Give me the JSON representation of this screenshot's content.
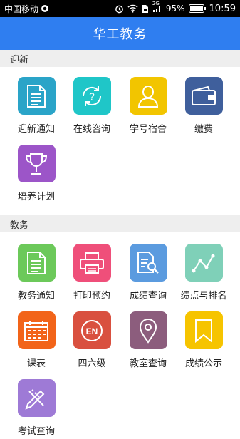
{
  "status_bar": {
    "carrier": "中国移动",
    "network": "2G",
    "battery": "95%",
    "time": "10:59"
  },
  "header": {
    "title": "华工教务"
  },
  "sections": [
    {
      "title": "迎新",
      "items": [
        {
          "label": "迎新通知",
          "icon": "document-icon",
          "color": "#2aa4c8"
        },
        {
          "label": "在线咨询",
          "icon": "help-refresh-icon",
          "color": "#1fc6c8"
        },
        {
          "label": "学号宿舍",
          "icon": "user-icon",
          "color": "#f2c500"
        },
        {
          "label": "缴费",
          "icon": "wallet-icon",
          "color": "#3f5f9c"
        },
        {
          "label": "培养计划",
          "icon": "trophy-icon",
          "color": "#9c55c8"
        }
      ]
    },
    {
      "title": "教务",
      "items": [
        {
          "label": "教务通知",
          "icon": "document-icon",
          "color": "#6cc95a"
        },
        {
          "label": "打印预约",
          "icon": "printer-icon",
          "color": "#ef4f7a"
        },
        {
          "label": "成绩查询",
          "icon": "document-search-icon",
          "color": "#5b9bdf"
        },
        {
          "label": "绩点与排名",
          "icon": "line-chart-icon",
          "color": "#7fd0b8"
        },
        {
          "label": "课表",
          "icon": "calendar-icon",
          "color": "#f26419"
        },
        {
          "label": "四六级",
          "icon": "en-badge-icon",
          "color": "#d9503f",
          "badge_text": "EN"
        },
        {
          "label": "教室查询",
          "icon": "location-pin-icon",
          "color": "#8c5d7d"
        },
        {
          "label": "成绩公示",
          "icon": "bookmark-icon",
          "color": "#f6c400"
        },
        {
          "label": "考试查询",
          "icon": "pencil-ruler-icon",
          "color": "#9e7ad6"
        }
      ]
    }
  ]
}
